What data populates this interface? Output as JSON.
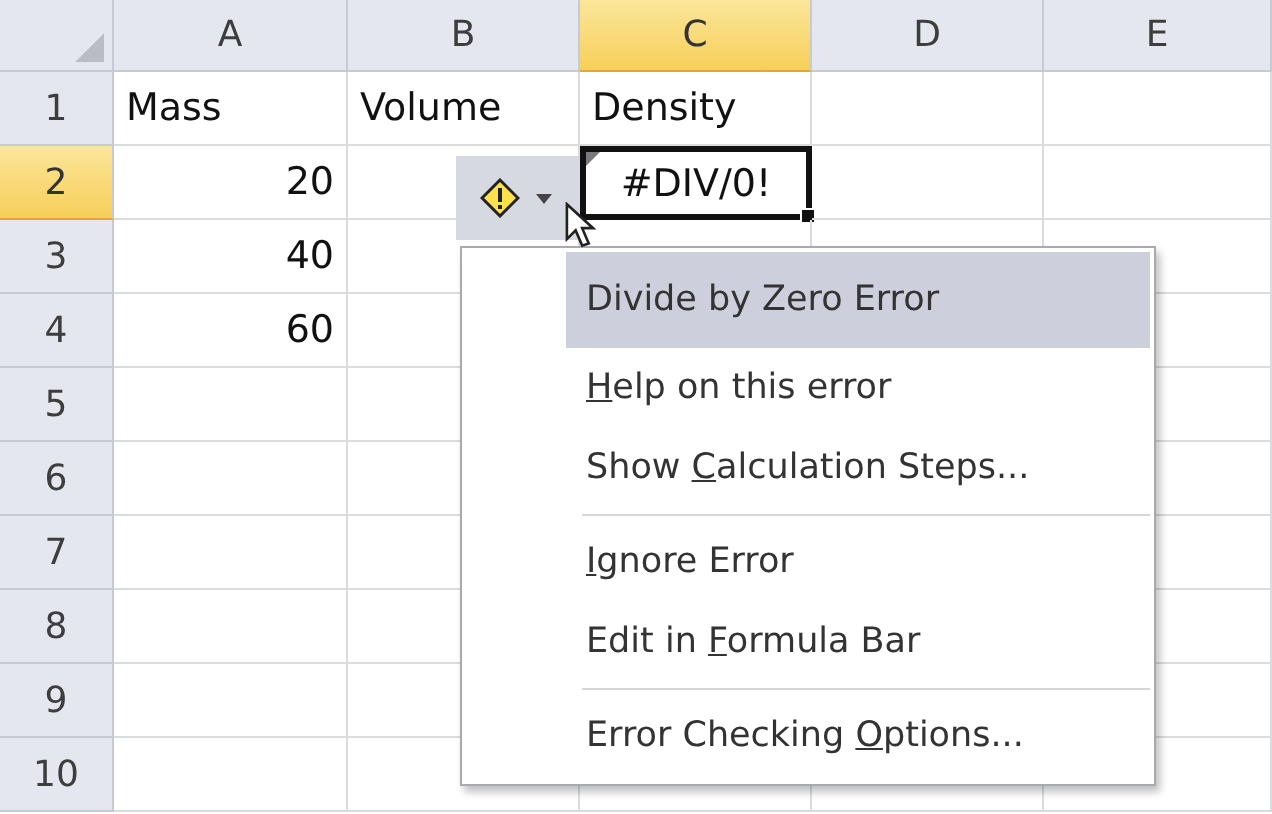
{
  "columns": [
    {
      "label": "A",
      "selected": false
    },
    {
      "label": "B",
      "selected": false
    },
    {
      "label": "C",
      "selected": true
    },
    {
      "label": "D",
      "selected": false
    },
    {
      "label": "E",
      "selected": false
    }
  ],
  "rows": [
    {
      "label": "1",
      "selected": false,
      "cells": [
        {
          "value": "Mass",
          "kind": "text",
          "selected": false
        },
        {
          "value": "Volume",
          "kind": "text",
          "selected": false
        },
        {
          "value": "Density",
          "kind": "text",
          "selected": false
        }
      ]
    },
    {
      "label": "2",
      "selected": true,
      "cells": [
        {
          "value": "20",
          "kind": "number",
          "selected": false
        },
        null,
        {
          "value": "#DIV/0!",
          "kind": "error",
          "selected": true
        }
      ]
    },
    {
      "label": "3",
      "selected": false,
      "cells": [
        {
          "value": "40",
          "kind": "number",
          "selected": false
        }
      ]
    },
    {
      "label": "4",
      "selected": false,
      "cells": [
        {
          "value": "60",
          "kind": "number",
          "selected": false
        }
      ]
    },
    {
      "label": "5",
      "selected": false
    },
    {
      "label": "6",
      "selected": false
    },
    {
      "label": "7",
      "selected": false
    },
    {
      "label": "8",
      "selected": false
    },
    {
      "label": "9",
      "selected": false
    },
    {
      "label": "10",
      "selected": false
    }
  ],
  "error_menu": {
    "items": [
      {
        "kind": "header",
        "label": "Divide by Zero Error"
      },
      {
        "kind": "action",
        "key": "H",
        "after": "elp on this error"
      },
      {
        "kind": "action",
        "before": "Show ",
        "key": "C",
        "after": "alculation Steps..."
      },
      {
        "kind": "separator"
      },
      {
        "kind": "action",
        "key": "I",
        "after": "gnore Error"
      },
      {
        "kind": "action",
        "before": "Edit in ",
        "key": "F",
        "after": "ormula Bar"
      },
      {
        "kind": "separator"
      },
      {
        "kind": "action",
        "before": "Error Checking ",
        "key": "O",
        "after": "ptions..."
      }
    ]
  }
}
